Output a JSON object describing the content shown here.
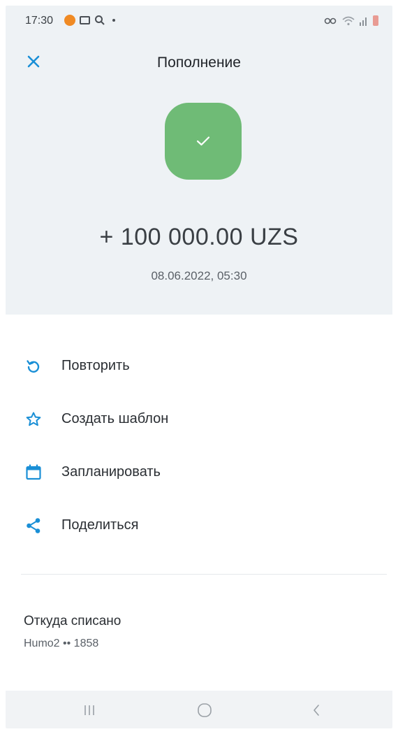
{
  "status_bar": {
    "time": "17:30"
  },
  "header": {
    "title": "Пополнение"
  },
  "transaction": {
    "amount": "+ 100 000.00 UZS",
    "datetime": "08.06.2022, 05:30",
    "status": "success",
    "status_color": "#6fbb76"
  },
  "actions": [
    {
      "label": "Повторить",
      "icon": "repeat-icon"
    },
    {
      "label": "Создать шаблон",
      "icon": "star-icon"
    },
    {
      "label": "Запланировать",
      "icon": "calendar-icon"
    },
    {
      "label": "Поделиться",
      "icon": "share-icon"
    }
  ],
  "source": {
    "label": "Откуда списано",
    "value": "Humo2 •• 1858"
  },
  "colors": {
    "accent": "#1a8fd6",
    "header_bg": "#eef2f5"
  },
  "nav_bar": {
    "buttons": [
      "recent-apps",
      "home",
      "back"
    ]
  }
}
